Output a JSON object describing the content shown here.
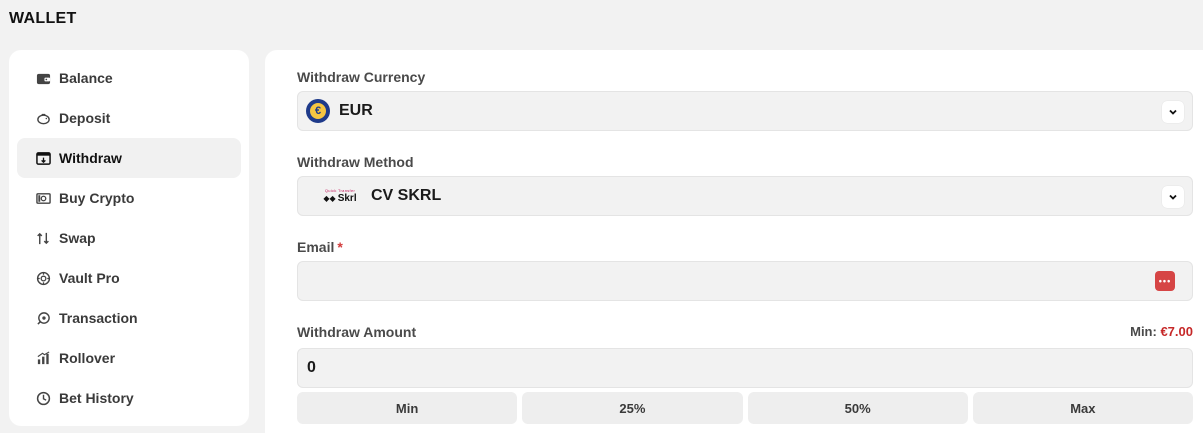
{
  "page": {
    "title": "WALLET"
  },
  "sidebar": {
    "items": [
      {
        "label": "Balance",
        "icon": "wallet-icon"
      },
      {
        "label": "Deposit",
        "icon": "piggy-bank-icon"
      },
      {
        "label": "Withdraw",
        "icon": "withdraw-icon",
        "active": true
      },
      {
        "label": "Buy Crypto",
        "icon": "cash-icon"
      },
      {
        "label": "Swap",
        "icon": "swap-icon"
      },
      {
        "label": "Vault Pro",
        "icon": "vault-icon"
      },
      {
        "label": "Transaction",
        "icon": "transaction-icon"
      },
      {
        "label": "Rollover",
        "icon": "rollover-icon"
      },
      {
        "label": "Bet History",
        "icon": "history-icon"
      }
    ]
  },
  "withdraw": {
    "currency_label": "Withdraw Currency",
    "currency_value": "EUR",
    "currency_symbol": "€",
    "method_label": "Withdraw Method",
    "method_value": "CV SKRL",
    "method_logo_small": "Quick Transfer",
    "method_logo_text": "Skrl",
    "email_label": "Email",
    "email_required_mark": "*",
    "email_value": "",
    "amount_label": "Withdraw Amount",
    "min_prefix": "Min:",
    "min_amount": "€7.00",
    "amount_value": "0",
    "quick_buttons": [
      "Min",
      "25%",
      "50%",
      "Max"
    ]
  },
  "colors": {
    "accent_red": "#c62828",
    "password_icon_bg": "#d64545",
    "eur_badge": "#1e3a8a"
  }
}
